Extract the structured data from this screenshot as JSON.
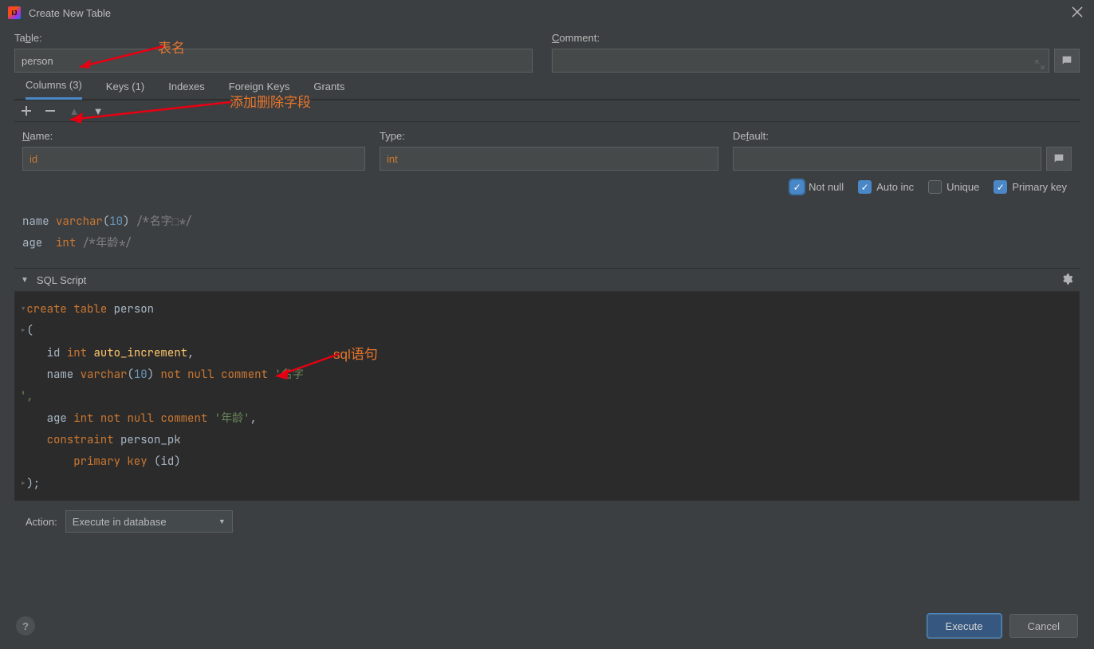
{
  "window": {
    "title": "Create New Table"
  },
  "labels": {
    "table": "Table:",
    "comment": "Comment:",
    "name": "Name:",
    "type": "Type:",
    "default": "Default:",
    "sql_script": "SQL Script",
    "action": "Action:"
  },
  "inputs": {
    "table_name": "person",
    "table_comment": "",
    "col_name": "id",
    "col_type": "int",
    "col_default": ""
  },
  "tabs": {
    "columns": "Columns (3)",
    "keys": "Keys (1)",
    "indexes": "Indexes",
    "foreign_keys": "Foreign Keys",
    "grants": "Grants"
  },
  "checks": {
    "not_null": "Not null",
    "auto_inc": "Auto inc",
    "unique": "Unique",
    "primary_key": "Primary key"
  },
  "column_list": [
    {
      "name": "name",
      "type": "varchar",
      "len": "10",
      "comment": "/*名字⬚*/"
    },
    {
      "name": "age",
      "type": "int",
      "len": "",
      "comment": "/*年龄*/"
    }
  ],
  "sql": {
    "l1": {
      "kw1": "create",
      "kw2": "table",
      "id": "person"
    },
    "l2": "(",
    "l3": {
      "col": "id",
      "type": "int",
      "auto": "auto_increment",
      "comma": ","
    },
    "l4": {
      "col": "name",
      "type": "varchar",
      "open": "(",
      "num": "10",
      "close": ")",
      "nn1": "not",
      "nn2": "null",
      "cmt": "comment",
      "str": "'名字"
    },
    "l5": "',",
    "l6": {
      "col": "age",
      "type": "int",
      "nn1": "not",
      "nn2": "null",
      "cmt": "comment",
      "str": "'年龄'",
      "comma": ","
    },
    "l7": {
      "kw": "constraint",
      "id": "person_pk"
    },
    "l8": {
      "kw": "primary key",
      "open": "(",
      "col": "id",
      "close": ")"
    },
    "l9": ");"
  },
  "action_combo": "Execute in database",
  "buttons": {
    "execute": "Execute",
    "cancel": "Cancel"
  },
  "annotations": {
    "table_name": "表名",
    "add_del": "添加删除字段",
    "sql": "sql语句"
  }
}
